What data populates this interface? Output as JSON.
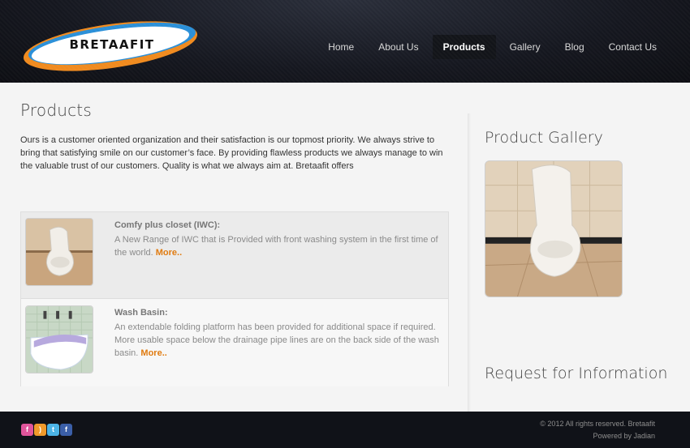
{
  "brand": {
    "logo_text": "BRETAAFIT"
  },
  "nav": {
    "items": [
      {
        "label": "Home"
      },
      {
        "label": "About Us"
      },
      {
        "label": "Products"
      },
      {
        "label": "Gallery"
      },
      {
        "label": "Blog"
      },
      {
        "label": "Contact Us"
      }
    ],
    "active": "Products"
  },
  "main": {
    "title": "Products",
    "intro": "Ours is a customer oriented organization and their satisfaction is our topmost priority. We always strive to bring that satisfying smile on our customer’s face. By providing flawless products we always manage to win the valuable trust of our customers. Quality is what we always aim at. Bretaafit offers",
    "products": [
      {
        "name": "Comfy plus closet (IWC):",
        "description": "A New Range of IWC that is Provided with front washing system in the first time of the world.",
        "more_label": "More.."
      },
      {
        "name": "Wash Basin:",
        "description": "An extendable folding platform has been provided for additional space if required. More usable space below the drainage pipe lines are on the back side of the wash basin.",
        "more_label": "More.."
      }
    ]
  },
  "sidebar": {
    "gallery_title": "Product Gallery",
    "request_title": "Request for Information"
  },
  "footer": {
    "social": [
      {
        "icon": "flickr-icon",
        "glyph": "f",
        "color": "#e0559b"
      },
      {
        "icon": "rss-icon",
        "glyph": ")",
        "color": "#f09a2b"
      },
      {
        "icon": "twitter-icon",
        "glyph": "t",
        "color": "#4cb4e6"
      },
      {
        "icon": "facebook-icon",
        "glyph": "f",
        "color": "#3b5fa8"
      }
    ],
    "copyright": "© 2012 All rights reserved. Bretaafit",
    "powered": "Powered by Jadian"
  },
  "colors": {
    "accent": "#e07b10",
    "logo_orange": "#f08a1e",
    "logo_blue": "#2a8fd8",
    "header_bg": "#15171f"
  }
}
